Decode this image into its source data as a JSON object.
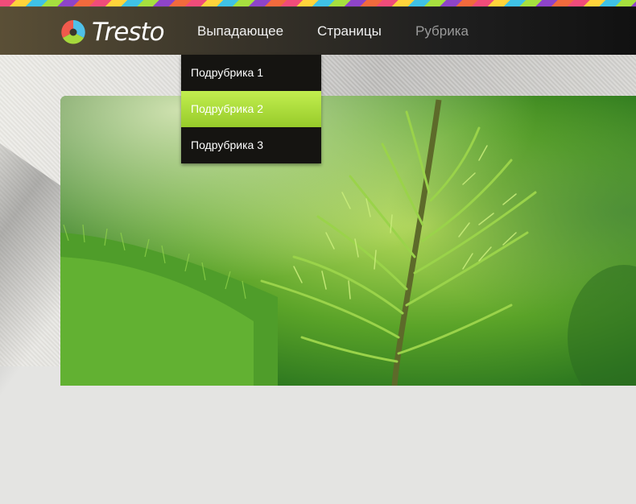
{
  "header": {
    "logo_text": "Tresto",
    "logo_icon": "tri-color-circle-logo",
    "colors": {
      "bar_dark": "#111111",
      "bar_warm": "#5a4f36",
      "stripe": [
        "#f04c7a",
        "#ffd43b",
        "#3fc2e6",
        "#a6e03f",
        "#8e44c9",
        "#f26a3d"
      ]
    }
  },
  "nav": {
    "items": [
      {
        "label": "Выпадающее",
        "state": "open"
      },
      {
        "label": "Страницы",
        "state": "normal"
      },
      {
        "label": "Рубрика",
        "state": "dim"
      }
    ]
  },
  "dropdown": {
    "items": [
      {
        "label": "Подрубрика 1"
      },
      {
        "label": "Подрубрика 2",
        "active": true
      },
      {
        "label": "Подрубрика 3"
      }
    ],
    "active_color": "#a6dc36"
  },
  "hero": {
    "image": "green-pine-sprout-photo"
  }
}
